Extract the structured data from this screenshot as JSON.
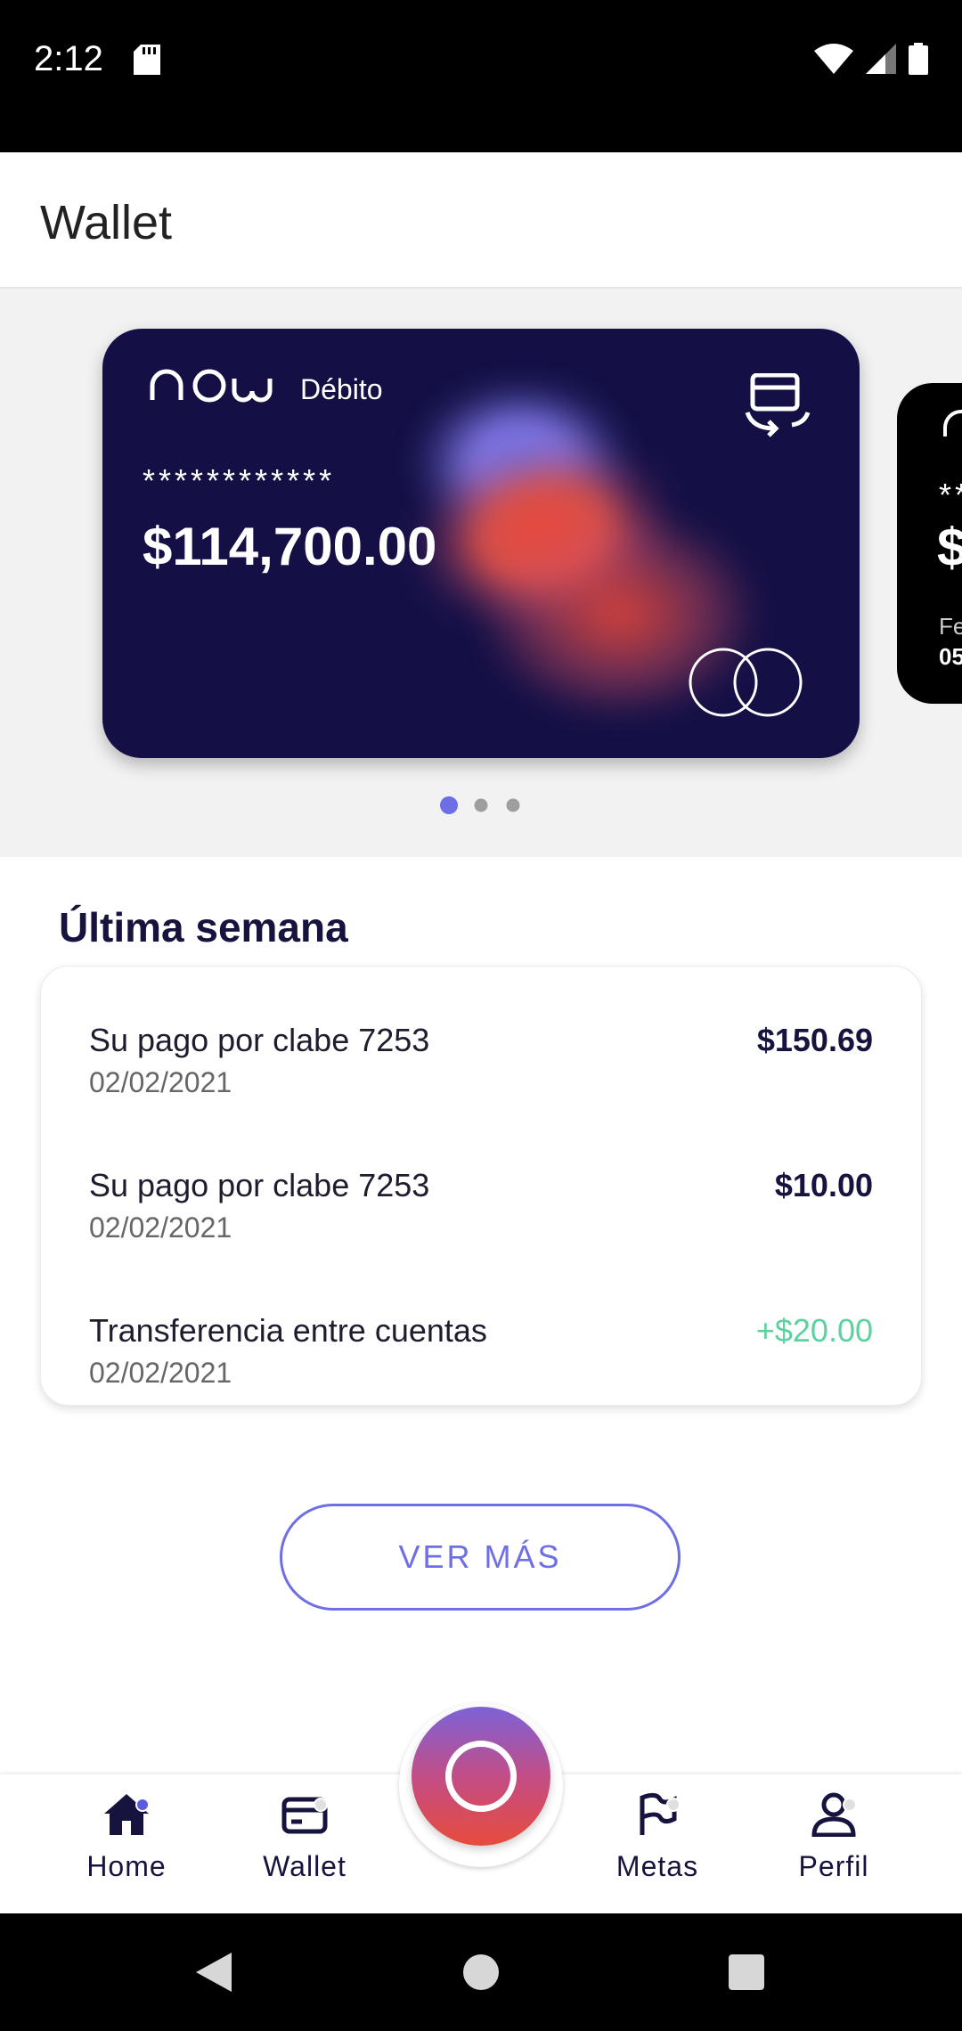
{
  "status_bar": {
    "time": "2:12",
    "icons": [
      "sd-card-icon",
      "wifi-icon",
      "signal-icon",
      "battery-icon"
    ]
  },
  "app_bar": {
    "title": "Wallet"
  },
  "cards": [
    {
      "type": "Débito",
      "masked_number": "************",
      "balance": "$114,700.00",
      "brand": "mastercard"
    },
    {
      "masked_number": "**",
      "balance": "$",
      "label_partial": "Fe",
      "value_partial": "05"
    }
  ],
  "carousel": {
    "page_count": 3,
    "active_index": 0
  },
  "section": {
    "title": "Última semana",
    "transactions": [
      {
        "name": "Su pago por clabe 7253",
        "date": "02/02/2021",
        "amount": "$150.69",
        "positive": false
      },
      {
        "name": "Su pago por clabe 7253",
        "date": "02/02/2021",
        "amount": "$10.00",
        "positive": false
      },
      {
        "name": "Transferencia entre cuentas",
        "date": "02/02/2021",
        "amount": "+$20.00",
        "positive": true
      }
    ],
    "more_button": "VER MÁS"
  },
  "bottom_nav": {
    "items": [
      {
        "label": "Home",
        "icon": "home-icon"
      },
      {
        "label": "Wallet",
        "icon": "wallet-icon"
      },
      {
        "label": "Metas",
        "icon": "flag-icon"
      },
      {
        "label": "Perfil",
        "icon": "person-icon"
      }
    ]
  },
  "colors": {
    "accent": "#6e6ee6",
    "card_bg": "#141046",
    "positive": "#5ed1a0",
    "heading": "#16143f"
  }
}
